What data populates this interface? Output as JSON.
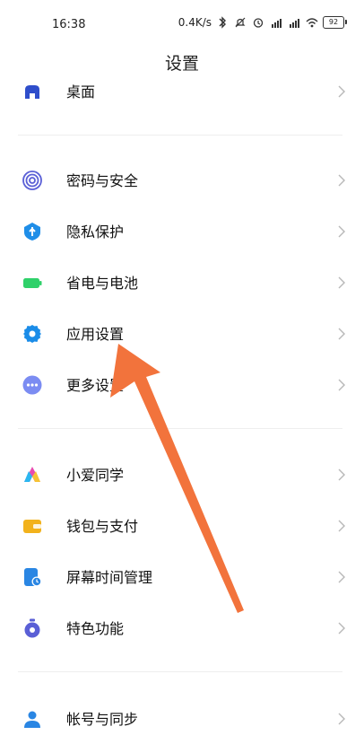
{
  "status_bar": {
    "time": "16:38",
    "network_speed": "0.4K/s",
    "icons": [
      "bluetooth-icon",
      "mute-icon",
      "alarm-icon",
      "signal-icon",
      "signal-icon",
      "wifi-icon"
    ],
    "battery_level": "92"
  },
  "header": {
    "title": "设置"
  },
  "groups": [
    {
      "items": [
        {
          "label": "桌面",
          "icon": "desktop-icon",
          "color": "#2f4ecb"
        }
      ]
    },
    {
      "items": [
        {
          "label": "密码与安全",
          "icon": "fingerprint-icon",
          "color": "#5a5fd6"
        },
        {
          "label": "隐私保护",
          "icon": "privacy-shield-icon",
          "color": "#1f8ee8"
        },
        {
          "label": "省电与电池",
          "icon": "battery-icon",
          "color": "#2fd16a"
        },
        {
          "label": "应用设置",
          "icon": "gear-icon",
          "color": "#1a8ce8"
        },
        {
          "label": "更多设置",
          "icon": "more-icon",
          "color": "#7b8cf2"
        }
      ]
    },
    {
      "items": [
        {
          "label": "小爱同学",
          "icon": "xiaoai-icon",
          "color": "#e84bb0"
        },
        {
          "label": "钱包与支付",
          "icon": "wallet-icon",
          "color": "#f2b21c"
        },
        {
          "label": "屏幕时间管理",
          "icon": "screen-time-icon",
          "color": "#2a86e3"
        },
        {
          "label": "特色功能",
          "icon": "feature-icon",
          "color": "#5a5fd6"
        }
      ]
    },
    {
      "items": [
        {
          "label": "帐号与同步",
          "icon": "account-icon",
          "color": "#2a86e3"
        }
      ]
    }
  ],
  "annotation": {
    "arrow_color": "#f2733c"
  }
}
